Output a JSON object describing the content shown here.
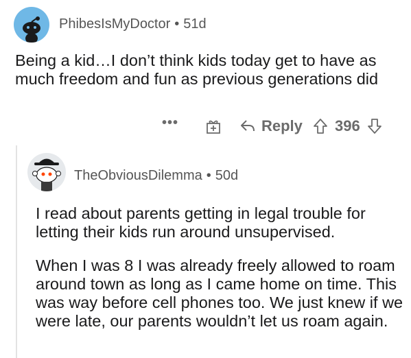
{
  "comment": {
    "username": "PhibesIsMyDoctor",
    "separator": "•",
    "age": "51d",
    "body": "Being a kid…I don’t think kids today get to have as much freedom and fun as previous generations did",
    "actions": {
      "more_label": "•••",
      "reply_label": "Reply",
      "vote_count": "396"
    }
  },
  "reply": {
    "username": "TheObviousDilemma",
    "separator": "•",
    "age": "50d",
    "paragraphs": [
      "I read about parents getting in legal trouble for letting their kids run around unsupervised.",
      "When I was 8 I was already freely allowed to roam around town as long as I came home on time. This was way before cell phones too. We just knew if we were late, our parents wouldn’t let us roam again."
    ]
  },
  "icons": {
    "avatar_top": "default-snoo-avatar-icon",
    "avatar_reply": "snoo-with-hat-avatar-icon",
    "more": "more-dots-icon",
    "award": "gift-award-icon",
    "reply": "reply-arrow-icon",
    "upvote": "upvote-arrow-icon",
    "downvote": "downvote-arrow-icon"
  },
  "colors": {
    "avatar_top_bg": "#6fb8e6",
    "text": "#1a1a1b",
    "meta": "#555555",
    "icon": "#6b6b6b"
  }
}
